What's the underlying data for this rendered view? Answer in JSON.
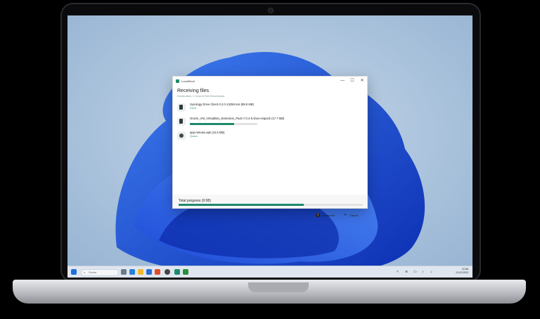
{
  "window": {
    "title": "LocalSend",
    "controls": {
      "minimize": "—",
      "maximize": "☐",
      "close": "✕"
    }
  },
  "transfer": {
    "heading": "Receiving files",
    "subheading": "Destination: C:\\Users\\Tien\\Downloads",
    "files": [
      {
        "name": "Synology Drive Client-3.2.0-13258.msi (88.8 MB)",
        "status": "Done",
        "icon": "document-icon",
        "progress": 1.0
      },
      {
        "name": "Oracle_VM_VirtualBox_Extension_Pack-7.0.4-6.vbox-extpack (17.7 MB)",
        "status": "",
        "icon": "document-icon",
        "progress": 0.66
      },
      {
        "name": "app-release.apk (24.5 MB)",
        "status": "Queue",
        "icon": "android-icon",
        "progress": 0
      }
    ],
    "total_label": "Total progress (0:08)",
    "total_progress": 0.68,
    "advanced_label": "Advanced",
    "cancel_label": "Cancel"
  },
  "taskbar": {
    "search_placeholder": "Suche",
    "time": "22:56",
    "date": "13.03.2023"
  },
  "colors": {
    "accent": "#1f8a6b",
    "taskbar": "#dfe6ef"
  }
}
